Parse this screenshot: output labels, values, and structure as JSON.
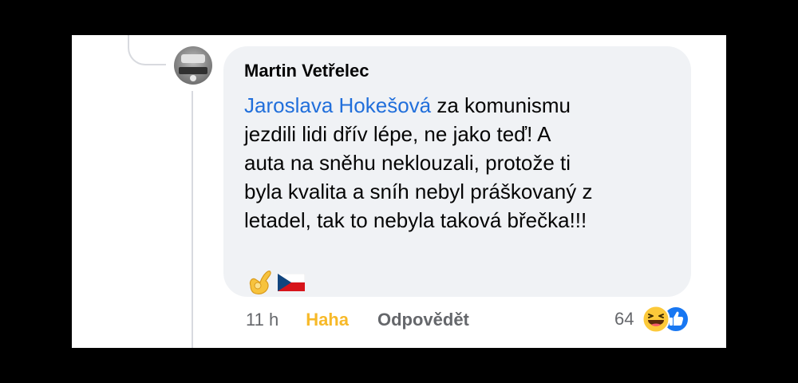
{
  "comment": {
    "author": "Martin Vetřelec",
    "mention": "Jaroslava Hokešová",
    "text_lines": [
      " za komunismu",
      "jezdili lidi dřív lépe, ne jako teď!  A",
      "auta na sněhu neklouzali, protože ti",
      "byla kvalita a sníh nebyl práškovaný z",
      "letadel, tak to nebyla taková břečka!!!"
    ],
    "emojis": [
      "ok-hand-icon",
      "czech-flag-icon"
    ]
  },
  "actions": {
    "time": "11 h",
    "reaction_label": "Haha",
    "reply_label": "Odpovědět"
  },
  "reactions": {
    "count": "64",
    "icons": [
      "haha-reaction-icon",
      "like-reaction-icon"
    ]
  },
  "colors": {
    "mention": "#216fdb",
    "haha": "#f7b928",
    "bubble": "#f0f2f5",
    "muted": "#65676b",
    "like": "#1877f2"
  }
}
